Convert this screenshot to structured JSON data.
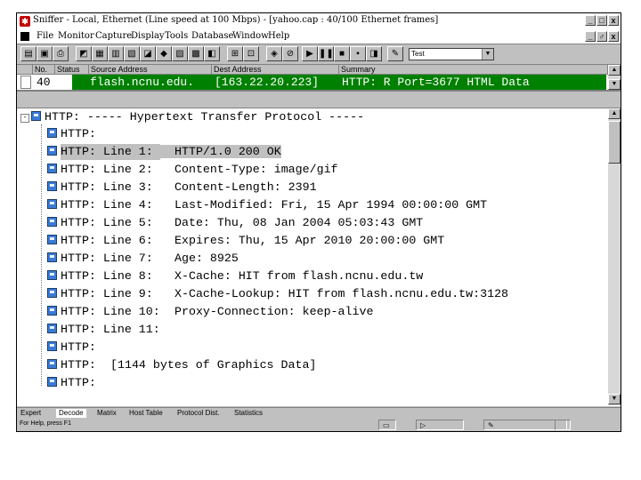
{
  "window": {
    "title": "Sniffer - Local, Ethernet (Line speed at 100 Mbps) - [yahoo.cap : 40/100 Ethernet frames]",
    "controls": [
      "_",
      "□",
      "x"
    ],
    "doc_controls": [
      "_",
      "♂",
      "x"
    ]
  },
  "menu": [
    "File",
    "Monitor",
    "Capture",
    "Display",
    "Tools",
    "Database",
    "Window",
    "Help"
  ],
  "toolbar": {
    "filter_value": "Test"
  },
  "summary": {
    "columns": [
      "No.",
      "Status",
      "Source Address",
      "Dest Address",
      "Summary"
    ],
    "row": {
      "no": "40",
      "status": "",
      "source": "flash.ncnu.edu.",
      "dest": "[163.22.20.223]",
      "summary": "HTTP: R Port=3677 HTML Data"
    }
  },
  "decode": {
    "header": "HTTP: ----- Hypertext Transfer Protocol -----",
    "lines": [
      {
        "label": "HTTP:",
        "text": ""
      },
      {
        "label": "HTTP: Line  1:",
        "text": "HTTP/1.0 200 OK"
      },
      {
        "label": "HTTP: Line  2:",
        "text": "Content-Type: image/gif"
      },
      {
        "label": "HTTP: Line  3:",
        "text": "Content-Length: 2391"
      },
      {
        "label": "HTTP: Line  4:",
        "text": "Last-Modified: Fri, 15 Apr 1994 00:00:00 GMT"
      },
      {
        "label": "HTTP: Line  5:",
        "text": "Date: Thu, 08 Jan 2004 05:03:43 GMT"
      },
      {
        "label": "HTTP: Line  6:",
        "text": "Expires: Thu, 15 Apr 2010 20:00:00 GMT"
      },
      {
        "label": "HTTP: Line  7:",
        "text": "Age: 8925"
      },
      {
        "label": "HTTP: Line  8:",
        "text": "X-Cache: HIT from flash.ncnu.edu.tw"
      },
      {
        "label": "HTTP: Line  9:",
        "text": "X-Cache-Lookup: HIT from flash.ncnu.edu.tw:3128"
      },
      {
        "label": "HTTP: Line 10:",
        "text": "Proxy-Connection: keep-alive"
      },
      {
        "label": "HTTP: Line 11:",
        "text": ""
      },
      {
        "label": "HTTP:",
        "text": ""
      },
      {
        "label": "HTTP:",
        "text": "[1144 bytes of Graphics Data]"
      },
      {
        "label": "HTTP:",
        "text": ""
      }
    ]
  },
  "tabs": [
    "Expert",
    "Decode",
    "Matrix",
    "Host Table",
    "Protocol Dist.",
    "Statistics"
  ],
  "status": {
    "help_text": "For Help, press F1"
  },
  "colors": {
    "summary_highlight": "#008000",
    "window_face": "#c0c0c0"
  }
}
